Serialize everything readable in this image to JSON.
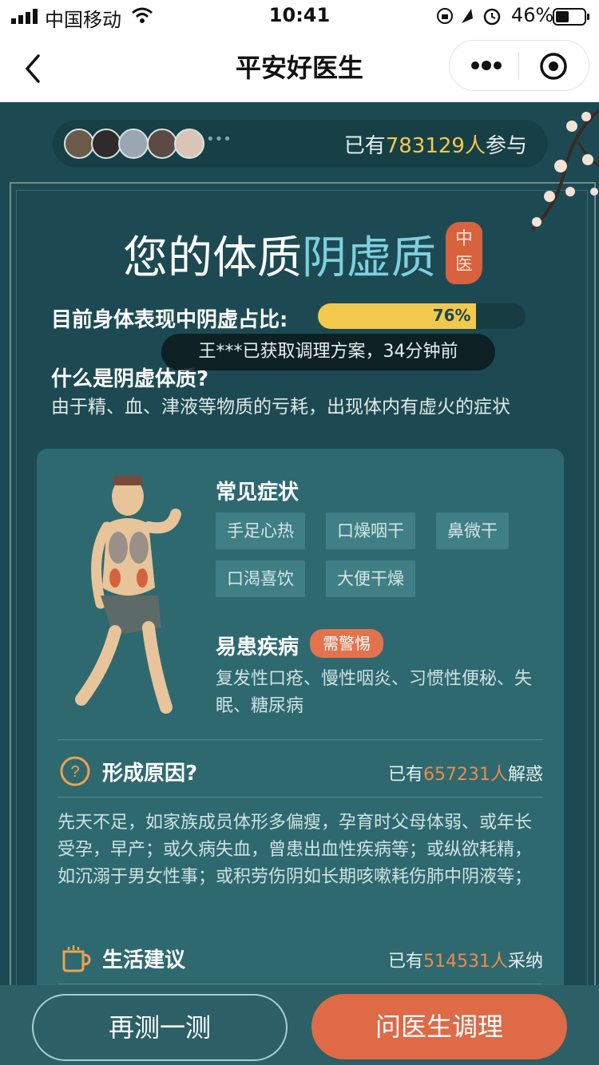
{
  "status_bar": {
    "carrier": "中国移动",
    "time": "10:41",
    "battery": "46%"
  },
  "nav": {
    "title": "平安好医生"
  },
  "participants": {
    "prefix": "已有",
    "count": "783129人",
    "suffix": "参与",
    "more": "•••"
  },
  "heading": {
    "prefix": "您的体质",
    "type": "阴虚质",
    "seal_top": "中",
    "seal_bottom": "医"
  },
  "ratio": {
    "label": "目前身体表现中阴虚占比:",
    "value": 0.76,
    "percent_text": "76%"
  },
  "toast": {
    "text": "王***已获取调理方案，34分钟前"
  },
  "what_is": {
    "question": "什么是阴虚体质?",
    "answer": "由于精、血、津液等物质的亏耗，出现体内有虚火的症状"
  },
  "symptoms": {
    "title": "常见症状",
    "tags": [
      "手足心热",
      "口燥咽干",
      "鼻微干",
      "口渴喜饮",
      "大便干燥"
    ]
  },
  "diseases": {
    "title": "易患疾病",
    "warning": "需警惕",
    "text": "复发性口疮、慢性咽炎、习惯性便秘、失眠、糖尿病"
  },
  "causes": {
    "title": "形成原因?",
    "prefix": "已有",
    "count": "657231人",
    "suffix": "解惑",
    "text": "先天不足，如家族成员体形多偏瘦，孕育时父母体弱、或年长受孕，早产；或久病失血，曾患出血性疾病等；或纵欲耗精，如沉溺于男女性事；或积劳伤阴如长期咳嗽耗伤肺中阴液等；"
  },
  "advice": {
    "title": "生活建议",
    "prefix": "已有",
    "count": "514531人",
    "suffix": "采纳"
  },
  "buttons": {
    "retest": "再测一测",
    "consult": "问医生调理"
  },
  "colors": {
    "background": "#1d4a52",
    "card": "#2e6970",
    "gold": "#f2c94c",
    "orange": "#f08b4a",
    "accent_button": "#de6a47"
  }
}
